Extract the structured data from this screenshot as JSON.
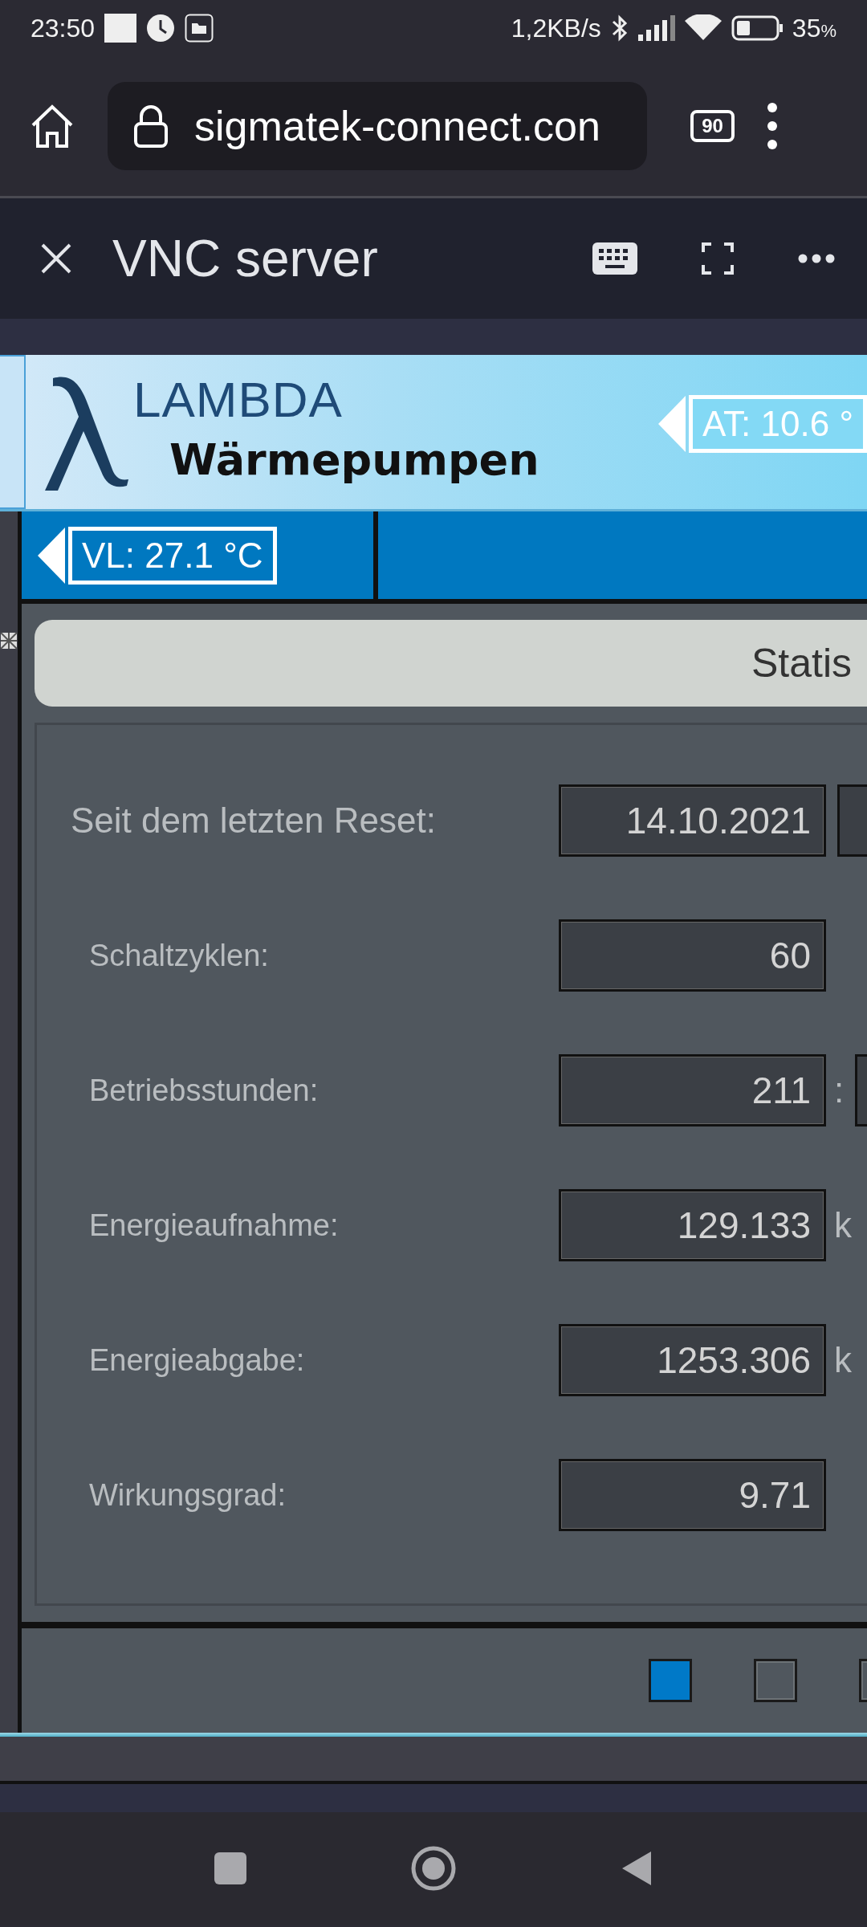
{
  "status_bar": {
    "time": "23:50",
    "net_speed": "1,2KB/s",
    "battery": "35",
    "battery_unit": "%"
  },
  "browser": {
    "url": "sigmatek-connect.con",
    "tab_count": "90"
  },
  "app_bar": {
    "title": "VNC server"
  },
  "hmi": {
    "brand": {
      "name": "LAMBDA",
      "tagline": "Wärmepumpen"
    },
    "outdoor_temp": "AT:  10.6 °",
    "flow_temp": "VL:  27.1 °C",
    "panel_title": "Statis",
    "rows": [
      {
        "kind": "heading",
        "label": "Seit dem letzten Reset:",
        "value": "14.10.2021",
        "trailing_field": true
      },
      {
        "kind": "plain",
        "label": "Schaltzyklen:",
        "value": "60",
        "trailing_field": false
      },
      {
        "kind": "plain",
        "label": "Betriebsstunden:",
        "value": "211",
        "unit": ":",
        "trailing_field": true
      },
      {
        "kind": "plain",
        "label": "Energieaufnahme:",
        "value": "129.133",
        "unit": "k",
        "trailing_field": false
      },
      {
        "kind": "plain",
        "label": "Energieabgabe:",
        "value": "1253.306",
        "unit": "k",
        "trailing_field": false
      },
      {
        "kind": "plain",
        "label": "Wirkungsgrad:",
        "value": "9.71",
        "trailing_field": false
      }
    ],
    "pages": [
      {
        "selected": true
      },
      {
        "selected": false
      },
      {
        "selected": false
      }
    ]
  }
}
